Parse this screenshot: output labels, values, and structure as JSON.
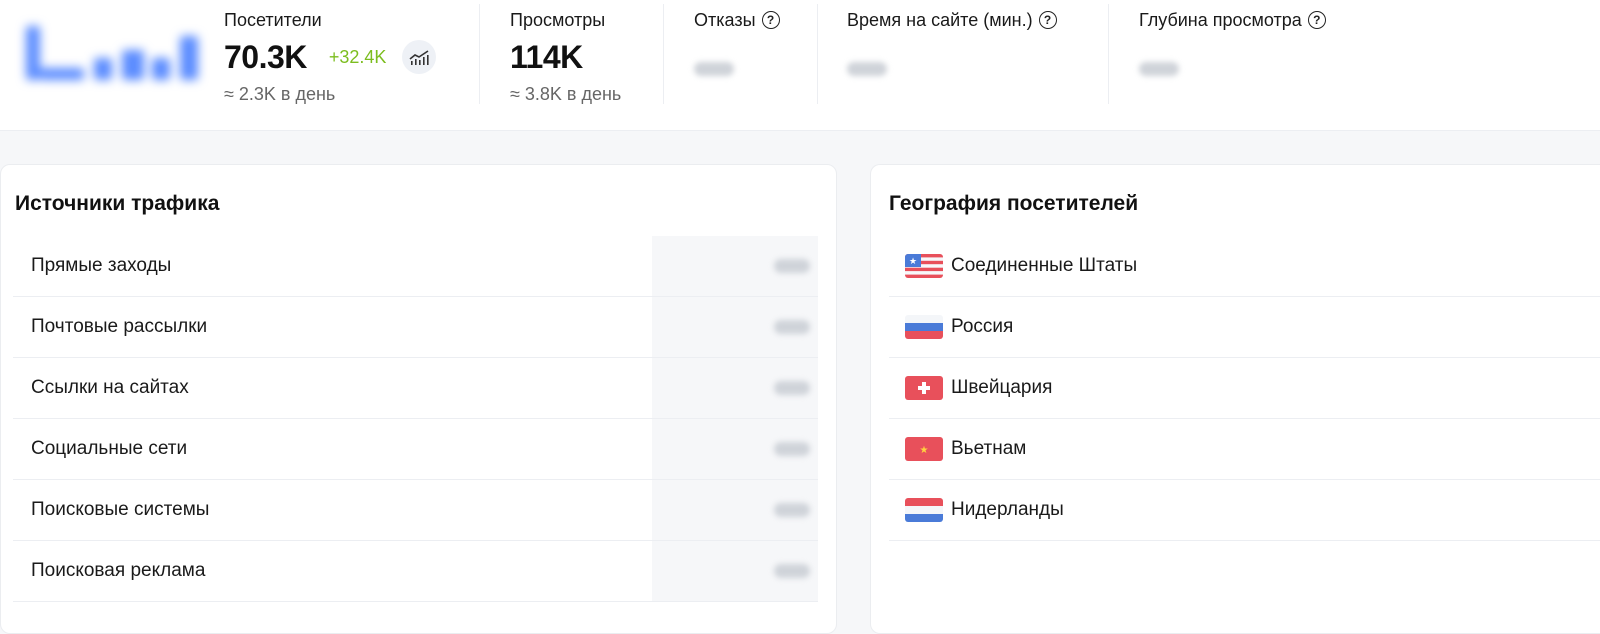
{
  "colors": {
    "accent_blue": "#5b8cff",
    "delta_green": "#7cbd1f",
    "muted_text": "#666666"
  },
  "metrics": {
    "visitors": {
      "label": "Посетители",
      "value": "70.3K",
      "delta": "+32.4K",
      "per_day": "≈ 2.3K в день"
    },
    "views": {
      "label": "Просмотры",
      "value": "114K",
      "per_day": "≈ 3.8K в день"
    },
    "bounces": {
      "label": "Отказы",
      "help": "?"
    },
    "time_on_site": {
      "label": "Время на сайте (мин.)",
      "help": "?"
    },
    "depth": {
      "label": "Глубина просмотра",
      "help": "?"
    }
  },
  "traffic_sources": {
    "title": "Источники трафика",
    "items": [
      {
        "label": "Прямые заходы"
      },
      {
        "label": "Почтовые рассылки"
      },
      {
        "label": "Ссылки на сайтах"
      },
      {
        "label": "Социальные сети"
      },
      {
        "label": "Поисковые системы"
      },
      {
        "label": "Поисковая реклама"
      }
    ]
  },
  "geography": {
    "title": "География посетителей",
    "items": [
      {
        "label": "Соединенные Штаты",
        "flag": "us-flag-icon"
      },
      {
        "label": "Россия",
        "flag": "ru-flag-icon"
      },
      {
        "label": "Швейцария",
        "flag": "ch-flag-icon"
      },
      {
        "label": "Вьетнам",
        "flag": "vn-flag-icon"
      },
      {
        "label": "Нидерланды",
        "flag": "nl-flag-icon"
      }
    ]
  }
}
